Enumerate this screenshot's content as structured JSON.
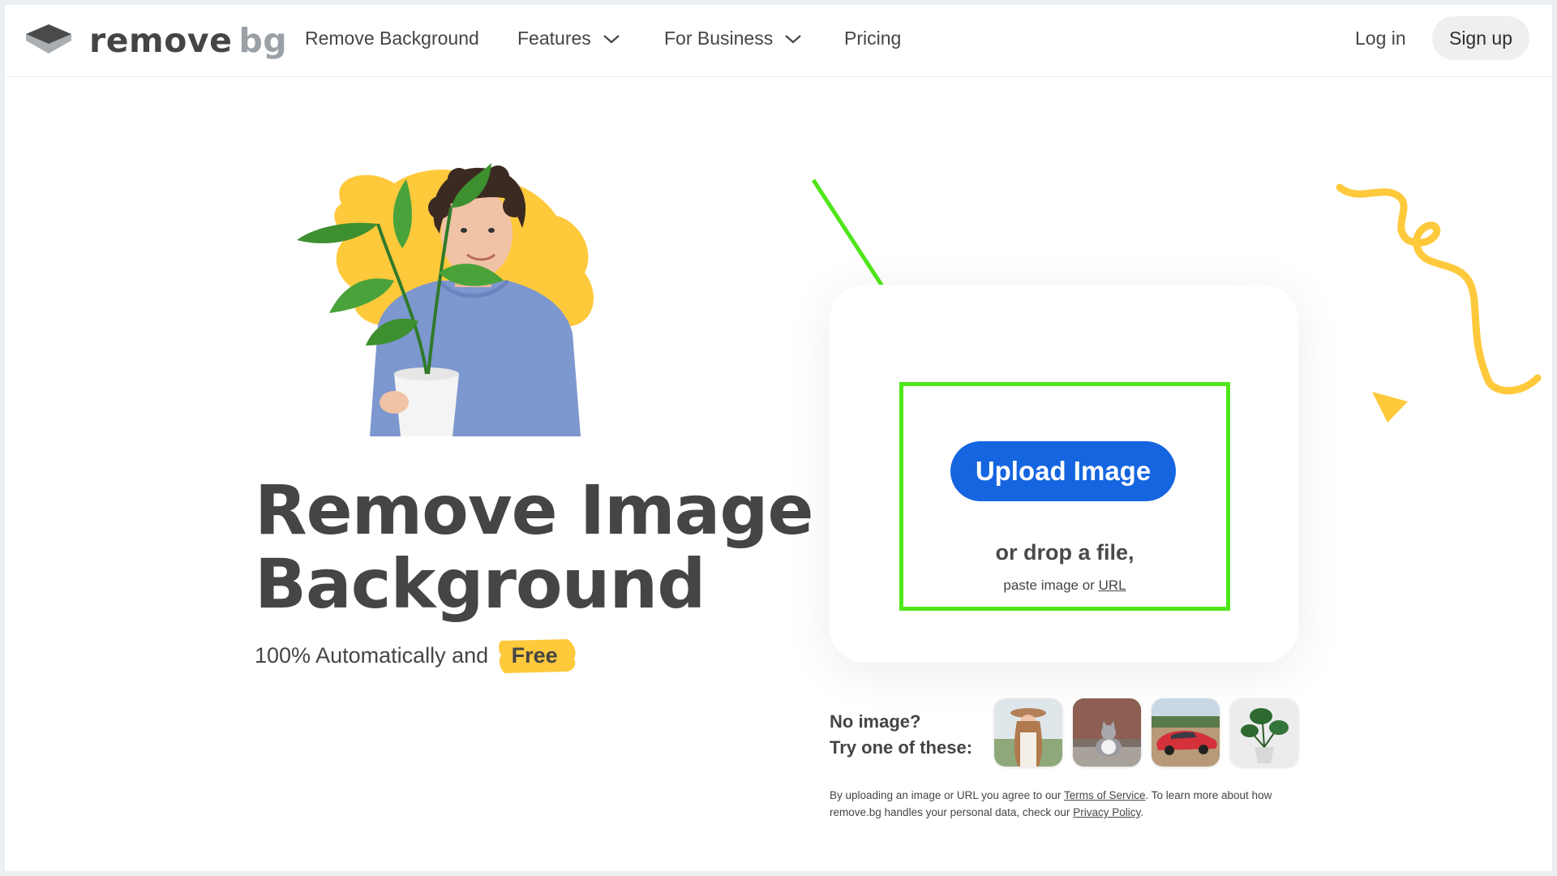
{
  "logo": {
    "word1": "remove",
    "word2": "bg"
  },
  "nav": {
    "remove_background": "Remove Background",
    "features": "Features",
    "for_business": "For Business",
    "pricing": "Pricing",
    "login": "Log in",
    "signup": "Sign up"
  },
  "hero": {
    "title_line1": "Remove Image",
    "title_line2": "Background",
    "subtitle": "100% Automatically and",
    "badge": "Free"
  },
  "upload": {
    "button": "Upload Image",
    "drop_text": "or drop a file,",
    "paste_prefix": "paste image or",
    "url_link": "URL"
  },
  "samples": {
    "line1": "No image?",
    "line2": "Try one of these:",
    "thumbnails": [
      "woman",
      "cat",
      "car",
      "plant"
    ]
  },
  "legal": {
    "part1": "By uploading an image or URL you agree to our",
    "tos": "Terms of Service",
    "part2": ". To learn more about how remove.bg handles your personal data, check our",
    "privacy": "Privacy Policy",
    "part3": "."
  },
  "colors": {
    "accent_blue": "#1565e0",
    "highlight_yellow": "#ffc93c",
    "annotation_green": "#4fe61a"
  }
}
